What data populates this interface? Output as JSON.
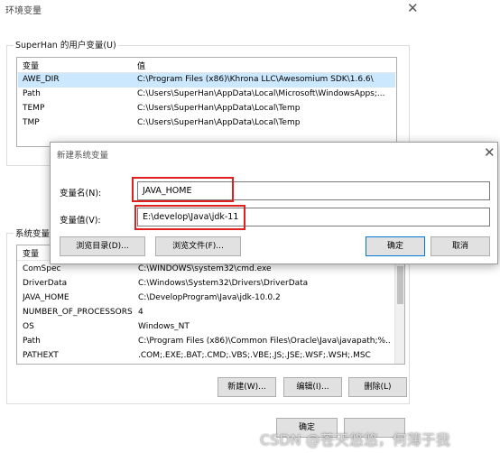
{
  "window": {
    "title": "环境变量"
  },
  "user_vars": {
    "group_label": "SuperHan 的用户变量(U)",
    "col_var": "变量",
    "col_val": "值",
    "rows": [
      {
        "name": "AWE_DIR",
        "value": "C:\\Program Files (x86)\\Khrona LLC\\Awesomium SDK\\1.6.6\\"
      },
      {
        "name": "Path",
        "value": "C:\\Users\\SuperHan\\AppData\\Local\\Microsoft\\WindowsApps;..."
      },
      {
        "name": "TEMP",
        "value": "C:\\Users\\SuperHan\\AppData\\Local\\Temp"
      },
      {
        "name": "TMP",
        "value": "C:\\Users\\SuperHan\\AppData\\Local\\Temp"
      }
    ]
  },
  "system_vars": {
    "group_label": "系统变量(",
    "col_var": "变量",
    "rows": [
      {
        "name": "ComSpec",
        "value": "C:\\WINDOWS\\system32\\cmd.exe"
      },
      {
        "name": "DriverData",
        "value": "C:\\Windows\\System32\\Drivers\\DriverData"
      },
      {
        "name": "JAVA_HOME",
        "value": "C:\\DevelopProgram\\Java\\jdk-10.0.2"
      },
      {
        "name": "NUMBER_OF_PROCESSORS",
        "value": "4"
      },
      {
        "name": "OS",
        "value": "Windows_NT"
      },
      {
        "name": "Path",
        "value": "C:\\Program Files (x86)\\Common Files\\Oracle\\Java\\javapath;%..."
      },
      {
        "name": "PATHEXT",
        "value": ".COM;.EXE;.BAT;.CMD;.VBS;.VBE;.JS;.JSE;.WSF;.WSH;.MSC"
      }
    ],
    "buttons": {
      "new": "新建(W)...",
      "edit": "编辑(I)...",
      "delete": "删除(L)"
    }
  },
  "dialog": {
    "title": "新建系统变量",
    "name_label": "变量名(N):",
    "name_value": "JAVA_HOME",
    "value_label": "变量值(V):",
    "value_value": "E:\\develop\\Java\\jdk-11",
    "browse_dir": "浏览目录(D)...",
    "browse_file": "浏览文件(F)...",
    "ok": "确定",
    "cancel": "取消"
  },
  "footer": {
    "ok_partial": "确定"
  },
  "watermark": "CSDN @苍天悠悠，何薄于我",
  "icons": {
    "close": "close-icon"
  }
}
